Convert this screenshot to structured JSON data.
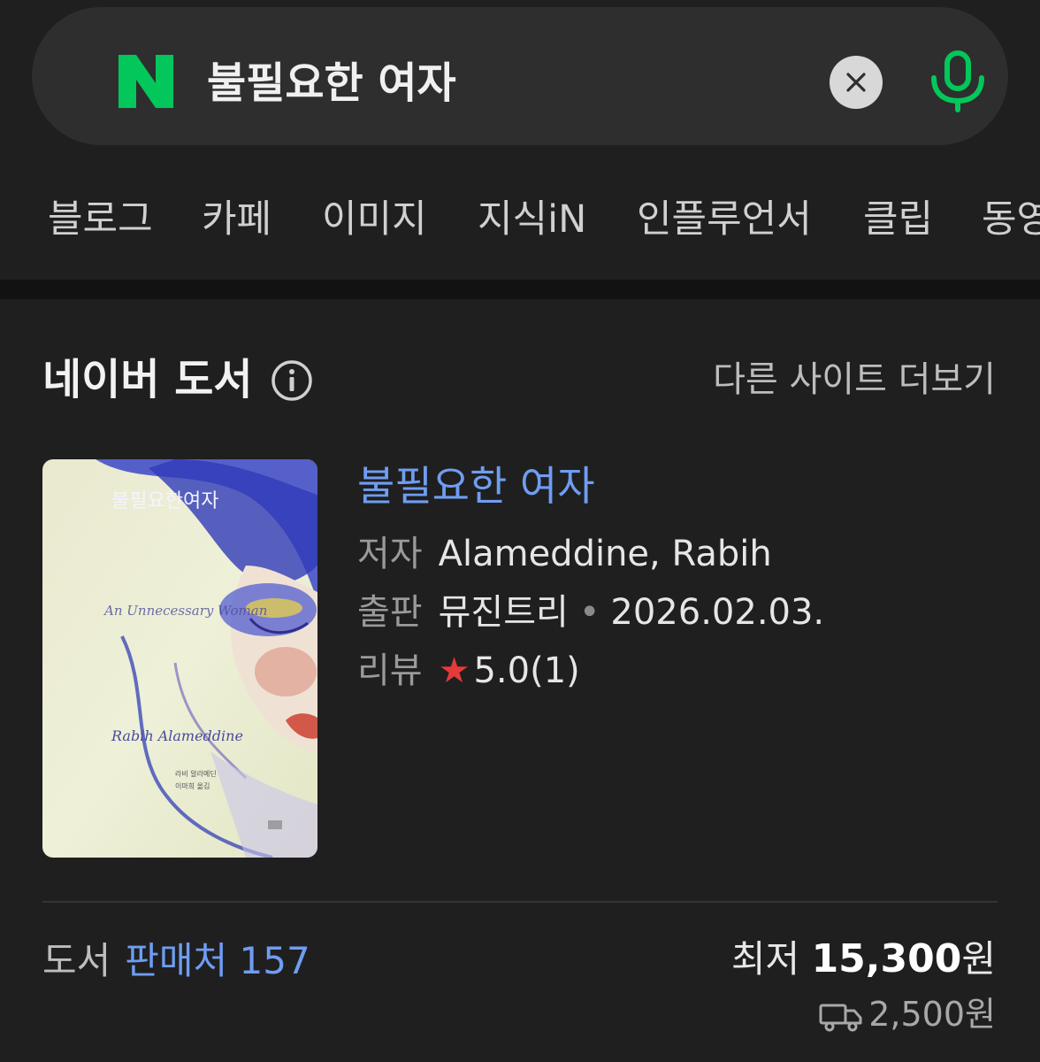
{
  "search": {
    "query": "불필요한 여자",
    "logo_letter": "N",
    "brand_color": "#03C75A"
  },
  "tabs": [
    "블로그",
    "카페",
    "이미지",
    "지식iN",
    "인플루언서",
    "클립",
    "동영상"
  ],
  "section": {
    "title": "네이버 도서",
    "more_link": "다른 사이트 더보기"
  },
  "book": {
    "title": "불필요한 여자",
    "author_label": "저자",
    "author": "Alameddine, Rabih",
    "publisher_label": "출판",
    "publisher": "뮤진트리",
    "date": "2026.02.03.",
    "review_label": "리뷰",
    "rating": "5.0(1)",
    "cover_text": {
      "title": "불필요한여자",
      "english": "An Unnecessary Woman",
      "author": "Rabih Alameddine",
      "credits_1": "라비 알라메딘",
      "credits_2": "이마희 옮김"
    }
  },
  "footer": {
    "category": "도서",
    "sellers_link": "판매처 157",
    "lowest_label": "최저",
    "lowest_price": "15,300",
    "currency": "원",
    "shipping": "2,500원"
  }
}
